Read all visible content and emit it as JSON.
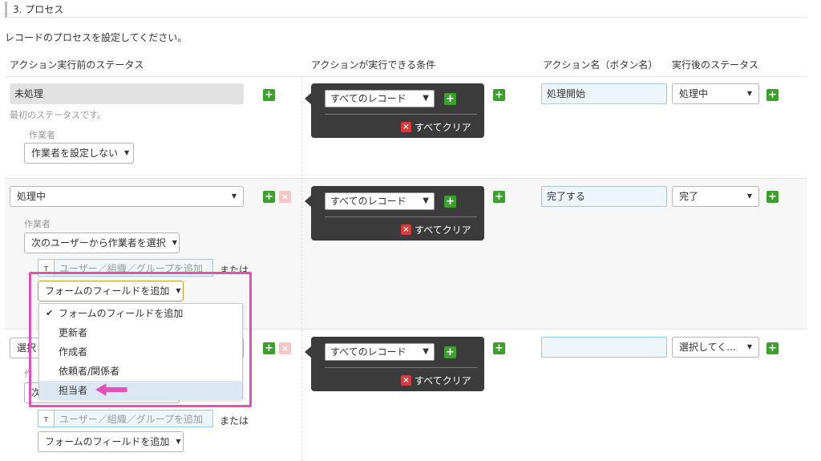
{
  "section": {
    "title": "3. プロセス",
    "description": "レコードのプロセスを設定してください。"
  },
  "headers": {
    "status_before": "アクション実行前のステータス",
    "condition": "アクションが実行できる条件",
    "action_name": "アクション名（ボタン名）",
    "status_after": "実行後のステータス"
  },
  "rows": [
    {
      "status": "未処理",
      "note": "最初のステータスです。",
      "assignee_label": "作業者",
      "assignee_select": "作業者を設定しない",
      "condition": {
        "select": "すべてのレコード",
        "clear": "すべてクリア"
      },
      "action_name": "処理開始",
      "after_status": "処理中"
    },
    {
      "status": "処理中",
      "assignee_label": "作業者",
      "assignee_select": "次のユーザーから作業者を選択",
      "user_placeholder": "ユーザー／組織／グループを追加",
      "or_label": "または",
      "field_select": "フォームのフィールドを追加",
      "condition": {
        "select": "すべてのレコード",
        "clear": "すべてクリア"
      },
      "action_name": "完了する",
      "after_status": "完了"
    },
    {
      "status": "選択し",
      "assignee_label": "作",
      "assignee_select": "次",
      "user_placeholder": "ユーザー／組織／グループを追加",
      "or_label": "または",
      "field_select": "フォームのフィールドを追加",
      "condition": {
        "select": "すべてのレコード",
        "clear": "すべてクリア"
      },
      "action_name": "",
      "after_status": "選択してく..."
    }
  ],
  "dropdown": {
    "items": [
      "フォームのフィールドを追加",
      "更新者",
      "作成者",
      "依頼者/関係者",
      "担当者"
    ],
    "checked_index": 0,
    "highlighted_index": 4
  },
  "icons": {
    "plus": "+",
    "remove": "×",
    "caret": "▼",
    "check": "✔",
    "org": "ᴛ"
  },
  "colors": {
    "highlight": "#e64fb4",
    "add": "#3ba12c",
    "clear": "#d93b3b"
  }
}
